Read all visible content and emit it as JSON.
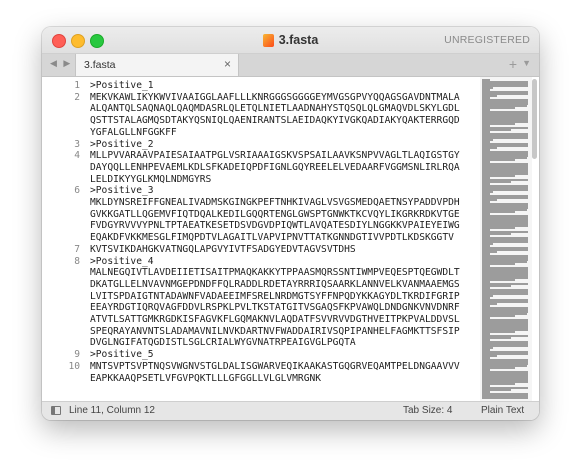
{
  "window": {
    "title": "3.fasta",
    "registration": "UNREGISTERED",
    "tab_label": "3.fasta",
    "tab_close": "×",
    "nav_arrows": "◀ ▶",
    "new_tab": "+",
    "tab_menu": "▼"
  },
  "gutter": [
    "1",
    "2",
    "",
    "",
    "",
    "3",
    "4",
    "",
    "",
    "6",
    "",
    "",
    "",
    "",
    "7",
    "8",
    "",
    "",
    "",
    "",
    "",
    "",
    "",
    "9",
    "10",
    ""
  ],
  "code_lines": [
    ">Positive_1",
    "MEKVKAWLIKYKWVIVAAIGGLAAFLLLKNRGGGSGGGGEYMVGSGPVYQQAGSGAVDNTMALA",
    "ALQANTQLSAQNAQLQAQMDASRLQLETQLNIETLAADNAHYSTQSQLQLGMAQVDLSKYLGDL",
    "QSTTSTALAGMQSDTAKYQSNIQLQAENIRANTSLAEIDAQKYIVGKQADIAKYQAKTERRGQD",
    "YGFALGLLNFGGKFF",
    ">Positive_2",
    "MLLPVVARAAVPAIESAIAATPGLVSRIAAAIGSKVSPSAILAAVKSNPVVAGLTLAQIGSTGY",
    "DAYQQLLENHPEVAEMLKDLSFKADEIQPDFIGNLGQYREELELVEDAARFVGGMSNLIRLRQA",
    "LELDIKYYGLKMQLNDMGYRS",
    ">Positive_3",
    "MKLDYNSREIFFGNEALIVADMSKGINGKPEFTNHKIVAGLVSVGSMEDQAETNSYPADDVPDH",
    "GVKKGATLLQGEMVFIQTDQALKEDILGQQRTENGLGWSPTGNWKTKCVQYLIKGRKRDKVTGE",
    "FVDGYRVVVYPNLTPTAEATKESETDSVDGVDPIQWTLAVQATESDIYLNGGKKVPAIEYEIWG",
    "EQAKDFVKKMESGLFIMQPDTVLAGAITLVAPVIPNVTTATKGNNDGTIVVPDTLKDSKGGTV",
    "KVTSVIKDAHGKVATNGQLAPGVYIVTFSADGYEDVTAGVSVTDHS",
    ">Positive_4",
    "MALNEGQIVTLAVDEIIETISAITPMAQKAKKYTPPAASMQRSSNTIWMPVEQESPTQEGWDLT",
    "DKATGLLELNVAVNMGEPDNDFFQLRADDLRDETAYRRRIQSAARKLANNVELKVANMAAEMGS",
    "LVITSPDAIGTNTADAWNFVADAEEIMFSRELNRDMGTSYFFNPQDYKKAGYDLTKRDIFGRIP",
    "EEAYRDGTIQRQVAGFDDVLRSPKLPVLTKSTATGITVSGAQSFKPVAWQLDNDGNKVNVDNRF",
    "ATVTLSATTGMKRGDKISFAGVKFLGQMAKNVLAQDATFSVVRVVDGTHVEITPKPVALDDVSL",
    "SPEQRAYANVNTSLADAMAVNILNVKDARTNVFWADDAIRIVSQPIPANHELFAGMKTTSFSIP",
    "DVGLNGIFATQGDISTLSGLCRIALWYGVNATRPEAIGVGLPGQTA",
    ">Positive_5",
    "MNTSVPTSVPTNQSVWGNVSTGLDALISGWARVEQIKAAKASTGQGRVEQAMTPELDNGAAVVV",
    "EAPKKAAQPSETLVFGVPQKTLLLGFGGLLVLGLVMRGNK"
  ],
  "status": {
    "position": "Line 11, Column 12",
    "tab_size": "Tab Size: 4",
    "syntax": "Plain Text"
  }
}
